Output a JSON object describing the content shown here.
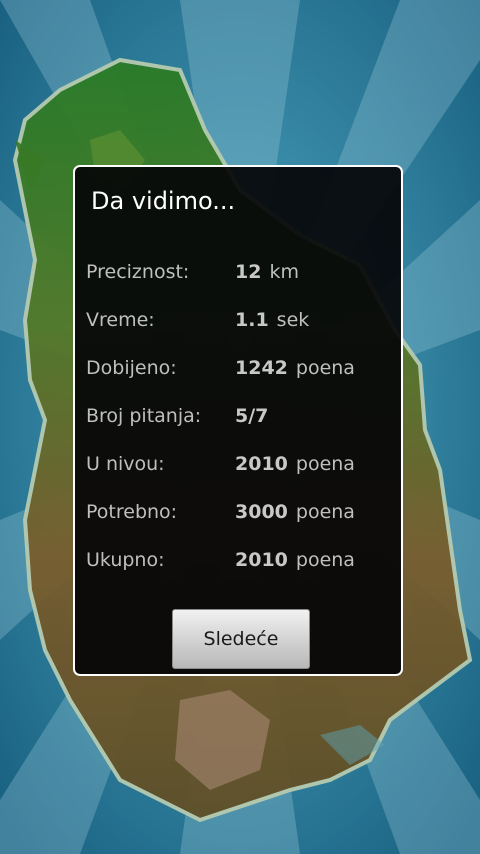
{
  "dialog": {
    "title": "Da vidimo...",
    "stats": [
      {
        "label": "Preciznost:",
        "value": "12",
        "unit": "km"
      },
      {
        "label": "Vreme:",
        "value": "1.1",
        "unit": "sek"
      },
      {
        "label": "Dobijeno:",
        "value": "1242",
        "unit": "poena"
      },
      {
        "label": "Broj pitanja:",
        "value": "5/7",
        "unit": ""
      },
      {
        "label": "U nivou:",
        "value": "2010",
        "unit": "poena"
      },
      {
        "label": "Potrebno:",
        "value": "3000",
        "unit": "poena"
      },
      {
        "label": "Ukupno:",
        "value": "2010",
        "unit": "poena"
      }
    ],
    "next_button_label": "Sledeće"
  },
  "colors": {
    "sea_blue": "#2a86ad",
    "ray_light": "#8fd0e6",
    "land_green": "#3f8a2a",
    "land_brown": "#8a5a2e",
    "dialog_border": "#ffffff"
  }
}
